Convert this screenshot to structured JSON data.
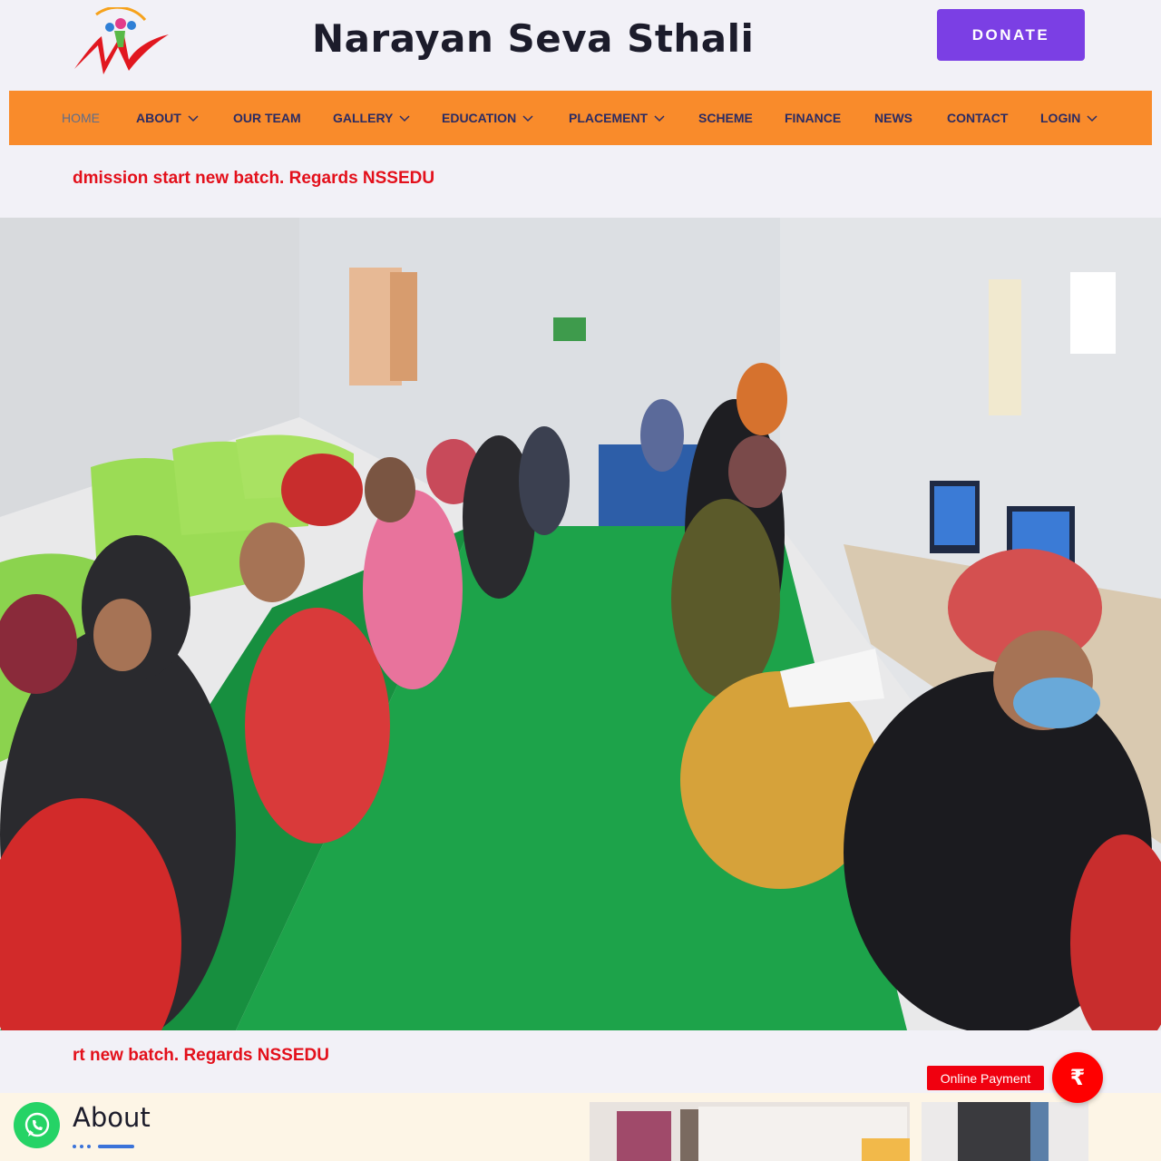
{
  "header": {
    "site_title": "Narayan Seva Sthali",
    "donate_label": "DONATE",
    "logo_icon": "nss-logo-icon"
  },
  "nav": {
    "items": [
      {
        "label": "HOME",
        "active": true,
        "dropdown": false
      },
      {
        "label": "ABOUT",
        "active": false,
        "dropdown": true
      },
      {
        "label": "OUR TEAM",
        "active": false,
        "dropdown": false
      },
      {
        "label": "GALLERY",
        "active": false,
        "dropdown": true
      },
      {
        "label": "EDUCATION",
        "active": false,
        "dropdown": true
      },
      {
        "label": "PLACEMENT",
        "active": false,
        "dropdown": true
      },
      {
        "label": "SCHEME",
        "active": false,
        "dropdown": false
      },
      {
        "label": "FINANCE",
        "active": false,
        "dropdown": false
      },
      {
        "label": "NEWS",
        "active": false,
        "dropdown": false
      },
      {
        "label": "CONTACT",
        "active": false,
        "dropdown": false
      },
      {
        "label": "LOGIN",
        "active": false,
        "dropdown": true
      }
    ]
  },
  "ticker": {
    "top_text": "dmission start new batch. Regards NSSEDU",
    "bottom_text": "rt new batch. Regards NSSEDU"
  },
  "about": {
    "title": "About"
  },
  "floating": {
    "online_payment_label": "Online Payment",
    "payment_symbol": "₹",
    "whatsapp_icon": "whatsapp-icon"
  },
  "colors": {
    "nav_bg": "#f98b2b",
    "nav_text": "#2b2b63",
    "donate_bg": "#7b3fe4",
    "ticker": "#e3101b",
    "payment": "#ff0000",
    "whatsapp": "#25d366",
    "page_bg": "#f2f1f7"
  }
}
